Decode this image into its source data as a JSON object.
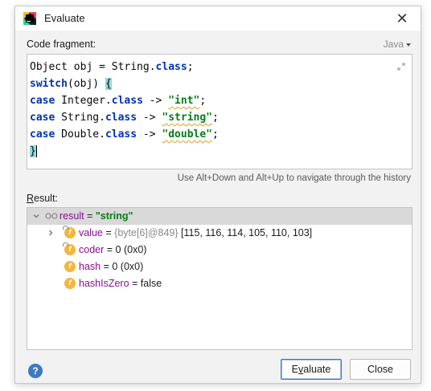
{
  "window": {
    "title": "Evaluate",
    "close_glyph": "✕"
  },
  "code_fragment": {
    "label": "Code fragment:",
    "language": "Java",
    "lines": [
      [
        {
          "t": "Object obj = String."
        },
        {
          "t": "class",
          "c": "kw"
        },
        {
          "t": ";"
        }
      ],
      [
        {
          "t": "switch",
          "c": "kw"
        },
        {
          "t": "(obj) "
        },
        {
          "t": "{",
          "c": "brace-hl"
        }
      ],
      [
        {
          "t": "case",
          "c": "kw"
        },
        {
          "t": " Integer."
        },
        {
          "t": "class",
          "c": "kw"
        },
        {
          "t": " -> "
        },
        {
          "t": "\"int\"",
          "c": "str squig"
        },
        {
          "t": ";"
        }
      ],
      [
        {
          "t": "case",
          "c": "kw"
        },
        {
          "t": " String."
        },
        {
          "t": "class",
          "c": "kw"
        },
        {
          "t": " -> "
        },
        {
          "t": "\"string\"",
          "c": "str squig"
        },
        {
          "t": ";"
        }
      ],
      [
        {
          "t": "case",
          "c": "kw"
        },
        {
          "t": " Double."
        },
        {
          "t": "class",
          "c": "kw"
        },
        {
          "t": " -> "
        },
        {
          "t": "\"double\"",
          "c": "str squig"
        },
        {
          "t": ";"
        }
      ],
      [
        {
          "t": "}",
          "c": "brace-hl"
        },
        {
          "caret": true
        }
      ]
    ]
  },
  "history_hint": "Use Alt+Down and Alt+Up to navigate through the history",
  "result": {
    "label_prefix": "R",
    "label_rest": "esult:",
    "root": {
      "name": "result",
      "eq": " = ",
      "value": "\"string\""
    },
    "fields": [
      {
        "name": "value",
        "eq": " = ",
        "type_hint": "{byte[6]@849} ",
        "value": "[115, 116, 114, 105, 110, 103]",
        "expandable": true,
        "locked": true
      },
      {
        "name": "coder",
        "eq": " = ",
        "type_hint": "",
        "value": "0 (0x0)",
        "expandable": false,
        "locked": true
      },
      {
        "name": "hash",
        "eq": " = ",
        "type_hint": "",
        "value": "0 (0x0)",
        "expandable": false,
        "locked": false
      },
      {
        "name": "hashIsZero",
        "eq": " = ",
        "type_hint": "",
        "value": "false",
        "expandable": false,
        "locked": false
      }
    ]
  },
  "footer": {
    "help_glyph": "?",
    "evaluate_prefix": "E",
    "evaluate_mnemonic": "v",
    "evaluate_rest": "aluate",
    "close_label": "Close"
  },
  "colors": {
    "keyword": "#0033b3",
    "string": "#067d17",
    "field_name": "#871094",
    "field_icon": "#f4b63f",
    "accent": "#3b79c4"
  }
}
